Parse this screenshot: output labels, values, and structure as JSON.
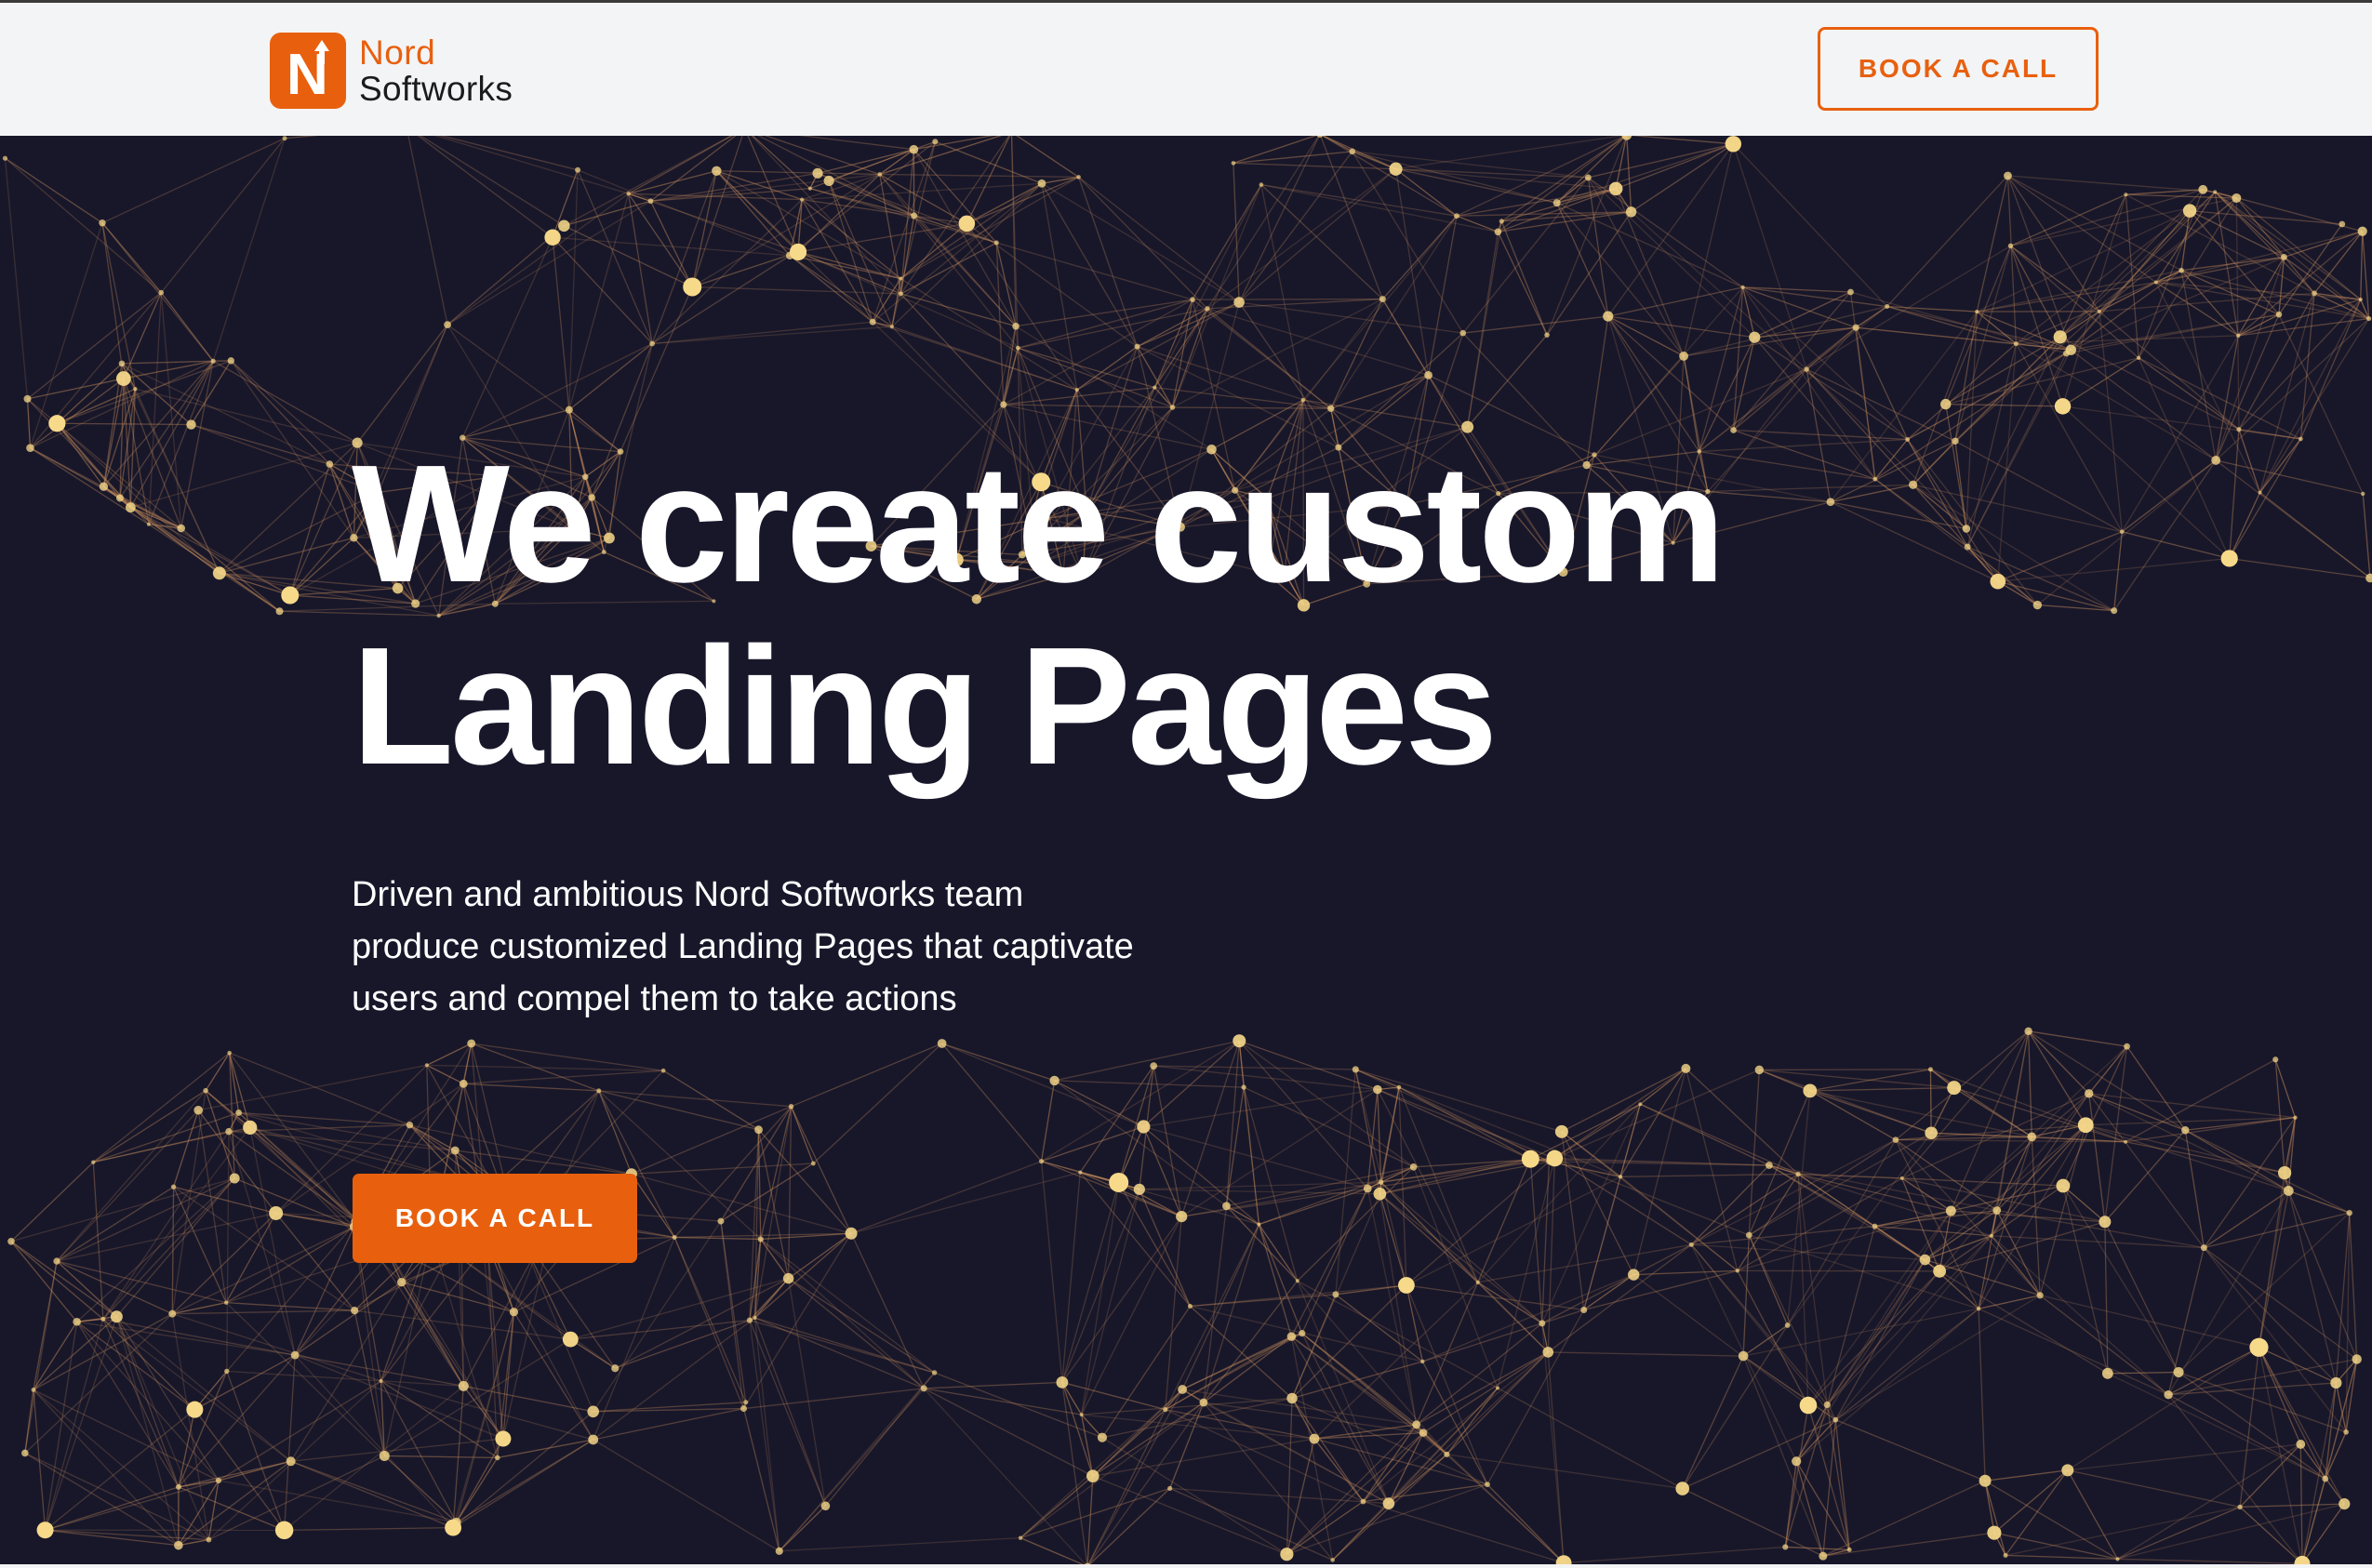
{
  "header": {
    "logo_word1": "Nord",
    "logo_word2": "Softworks",
    "logo_letter": "N",
    "cta_label": "BOOK A CALL"
  },
  "hero": {
    "title_line1": "We create custom",
    "title_line2": "Landing Pages",
    "subtitle_line1": "Driven and ambitious Nord Softworks team",
    "subtitle_line2": "produce customized Landing Pages that captivate",
    "subtitle_line3": "users and compel them to take actions",
    "cta_label": "BOOK A CALL",
    "background_icon": "network-constellation-background"
  },
  "colors": {
    "accent": "#e8600e",
    "hero_background": "#18172a",
    "header_background": "#f3f4f6",
    "node_color": "#f7d98a",
    "line_color": "#c28a5a"
  }
}
